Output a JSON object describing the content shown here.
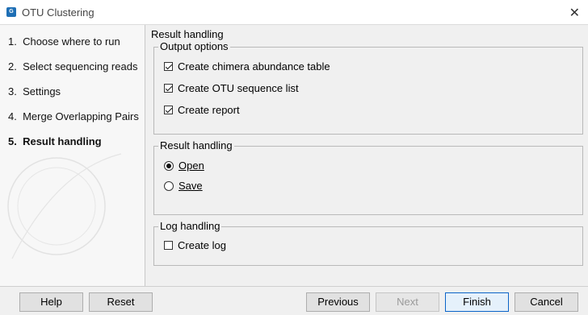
{
  "window": {
    "title": "OTU Clustering",
    "icon": "app-icon",
    "close_glyph": "✕"
  },
  "steps": [
    {
      "num": "1.",
      "label": "Choose where to run"
    },
    {
      "num": "2.",
      "label": "Select sequencing reads"
    },
    {
      "num": "3.",
      "label": "Settings"
    },
    {
      "num": "4.",
      "label": "Merge Overlapping Pairs"
    },
    {
      "num": "5.",
      "label": "Result handling"
    }
  ],
  "main": {
    "title": "Result handling",
    "output_options": {
      "legend": "Output options",
      "items": [
        {
          "label": "Create chimera abundance table",
          "checked": true
        },
        {
          "label": "Create OTU sequence list",
          "checked": true
        },
        {
          "label": "Create report",
          "checked": true
        }
      ]
    },
    "result_handling": {
      "legend": "Result handling",
      "open_label": "Open",
      "save_label": "Save",
      "selected": "Open"
    },
    "log_handling": {
      "legend": "Log handling",
      "create_log_label": "Create log",
      "checked": false
    }
  },
  "buttons": {
    "help": "Help",
    "reset": "Reset",
    "previous": "Previous",
    "next": "Next",
    "finish": "Finish",
    "cancel": "Cancel"
  }
}
